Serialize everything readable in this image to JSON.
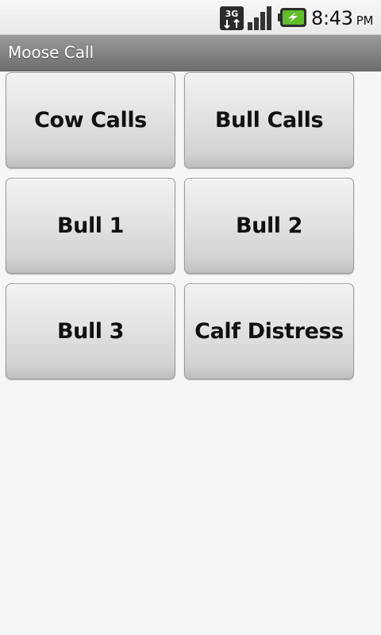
{
  "status_bar": {
    "network_icon": "3g-icon",
    "signal_icon": "signal-bars-icon",
    "battery_icon": "battery-charging-icon",
    "time": "8:43",
    "ampm": "PM"
  },
  "app": {
    "title": "Moose Call"
  },
  "buttons": [
    {
      "label": "Cow Calls"
    },
    {
      "label": "Bull Calls"
    },
    {
      "label": "Bull 1"
    },
    {
      "label": "Bull 2"
    },
    {
      "label": "Bull 3"
    },
    {
      "label": "Calf Distress"
    }
  ]
}
